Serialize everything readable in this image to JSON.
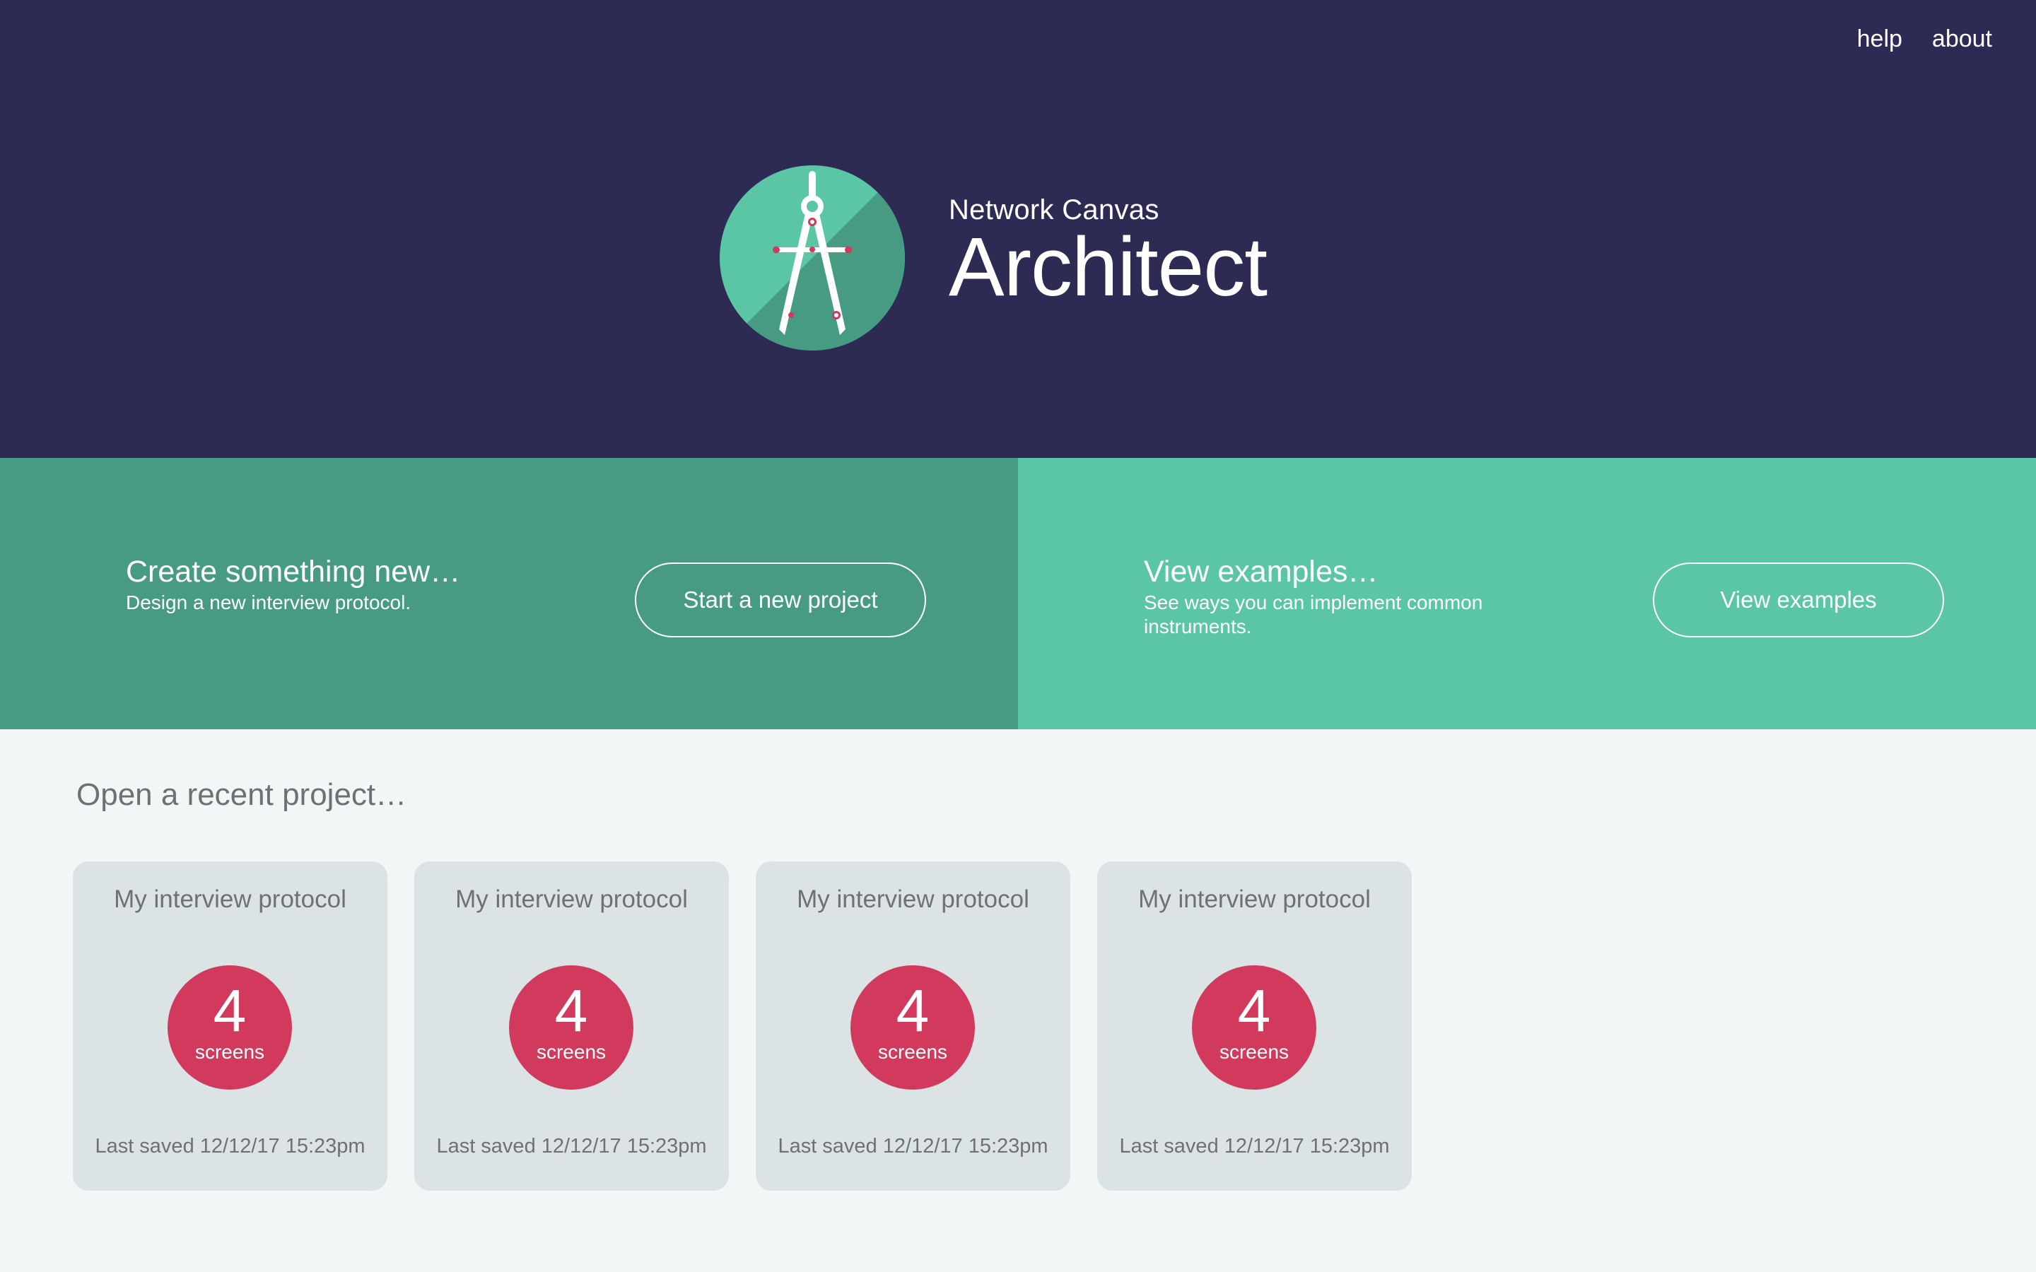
{
  "nav": {
    "help_label": "help",
    "about_label": "about"
  },
  "brand": {
    "subtitle": "Network Canvas",
    "title": "Architect",
    "logo_icon": "compass-icon"
  },
  "actions": {
    "create": {
      "heading": "Create something new…",
      "description": "Design a new interview protocol.",
      "button_label": "Start a new project"
    },
    "examples": {
      "heading": "View examples…",
      "description": "See ways you can implement common instruments.",
      "button_label": "View examples"
    }
  },
  "recent": {
    "heading": "Open a recent project…",
    "projects": [
      {
        "title": "My interview protocol",
        "screen_count": "4",
        "screen_label": "screens",
        "last_saved": "Last saved 12/12/17 15:23pm"
      },
      {
        "title": "My interview protocol",
        "screen_count": "4",
        "screen_label": "screens",
        "last_saved": "Last saved 12/12/17 15:23pm"
      },
      {
        "title": "My interview protocol",
        "screen_count": "4",
        "screen_label": "screens",
        "last_saved": "Last saved 12/12/17 15:23pm"
      },
      {
        "title": "My interview protocol",
        "screen_count": "4",
        "screen_label": "screens",
        "last_saved": "Last saved 12/12/17 15:23pm"
      }
    ]
  },
  "colors": {
    "header_bg": "#2d2a53",
    "create_panel_bg": "#489b83",
    "examples_panel_bg": "#5ac6a5",
    "page_bg": "#f2f6f6",
    "card_bg": "#dce3e5",
    "badge_bg": "#d1395d",
    "muted_text": "#6e7174"
  }
}
